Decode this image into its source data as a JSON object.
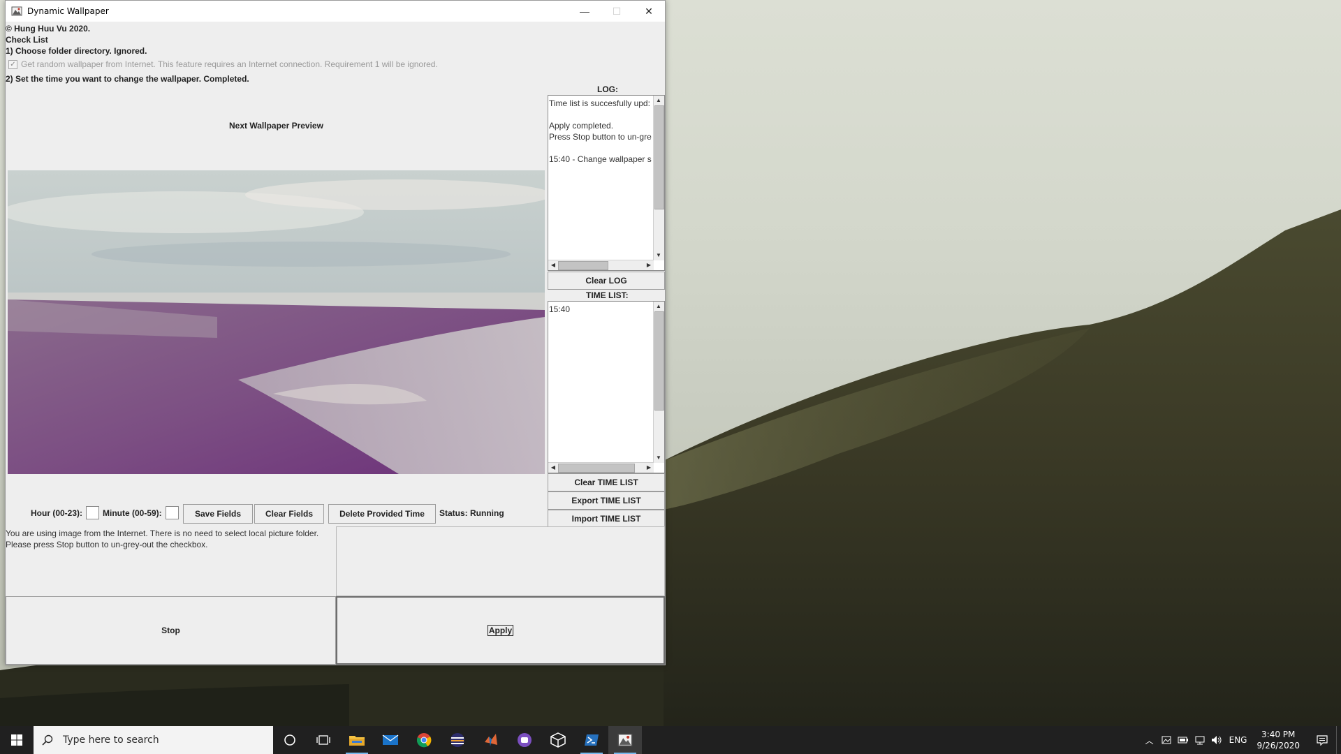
{
  "window": {
    "title": "Dynamic Wallpaper",
    "minimize": "—",
    "maximize": "☐",
    "close": "✕"
  },
  "header": {
    "copyright": "© Hung Huu Vu 2020.",
    "checklist_title": "Check List",
    "step1": "1) Choose folder directory. Ignored.",
    "random_checkbox_label": "Get random wallpaper from Internet. This feature requires an Internet connection. Requirement 1 will be ignored.",
    "random_checked": true,
    "step2": "2) Set the time you want to change the wallpaper. Completed."
  },
  "preview": {
    "label": "Next Wallpaper Preview"
  },
  "log": {
    "label": "LOG:",
    "text": "Time list is succesfully upd:\n\nApply completed.\nPress Stop button to un-gre\n\n15:40 - Change wallpaper s",
    "clear_label": "Clear LOG"
  },
  "time_list": {
    "label": "TIME LIST:",
    "text": "15:40",
    "clear_label": "Clear TIME LIST",
    "export_label": "Export TIME LIST",
    "import_label": "Import TIME LIST"
  },
  "controls": {
    "hour_label": "Hour (00-23):",
    "minute_label": "Minute (00-59):",
    "save_label": "Save Fields",
    "clear_label": "Clear Fields",
    "delete_label": "Delete Provided Time",
    "status_label": "Status: Running"
  },
  "message": {
    "line1": "You are using image from the Internet. There is no need to select local picture folder.",
    "line2": "Please press Stop button to un-grey-out the checkbox."
  },
  "actions": {
    "stop_label": "Stop",
    "apply_label": "Apply"
  },
  "taskbar": {
    "search_placeholder": "Type here to search",
    "icons": [
      "windows-start-icon",
      "cortana-icon",
      "task-view-icon",
      "file-explorer-icon",
      "mail-icon",
      "chrome-icon",
      "app-icon-lines",
      "app-icon-matlab",
      "app-icon-purple",
      "app-icon-virtualbox",
      "powershell-icon",
      "dynamic-wallpaper-icon"
    ],
    "language": "ENG",
    "time": "3:40 PM",
    "date": "9/26/2020"
  },
  "colors": {
    "accent_underline": "#76b9ed",
    "taskbar_bg": "#202020",
    "window_bg": "#eeeeee"
  }
}
